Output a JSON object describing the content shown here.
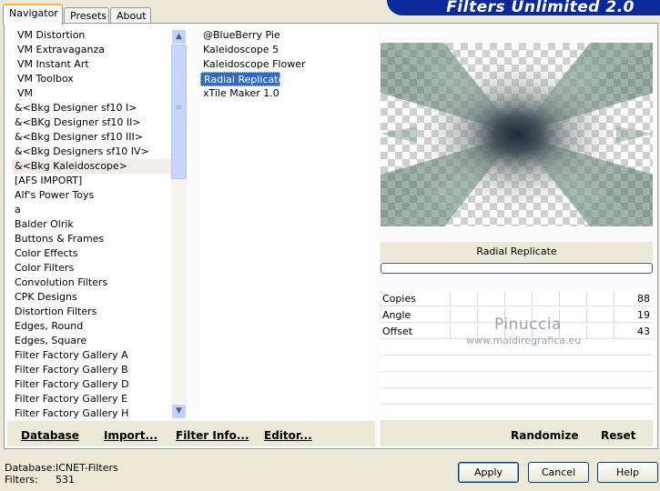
{
  "tabs": [
    {
      "label": "Navigator",
      "active": true
    },
    {
      "label": "Presets",
      "active": false
    },
    {
      "label": "About",
      "active": false
    }
  ],
  "banner_title": "Filters Unlimited 2.0",
  "categories": [
    "VM Distortion",
    "VM Extravaganza",
    "VM Instant Art",
    "VM Toolbox",
    "VM",
    "&<Bkg Designer sf10 I>",
    "&<BKg Designer sf10 II>",
    "&<Bkg Designer sf10 III>",
    "&<Bkg Designers sf10 IV>",
    "&<Bkg Kaleidoscope>",
    "[AFS IMPORT]",
    "Alf's Power Toys",
    "a",
    "Balder Olrik",
    "Buttons & Frames",
    "Color Effects",
    "Color Filters",
    "Convolution Filters",
    "CPK Designs",
    "Distortion Filters",
    "Edges, Round",
    "Edges, Square",
    "Filter Factory Gallery A",
    "Filter Factory Gallery B",
    "Filter Factory Gallery D",
    "Filter Factory Gallery E",
    "Filter Factory Gallery H"
  ],
  "selected_category": "&<Bkg Kaleidoscope>",
  "filters": [
    "@BlueBerry Pie",
    "Kaleidoscope 5",
    "Kaleidoscope Flower",
    "Radial Replicate",
    "xTile Maker 1.0"
  ],
  "selected_filter": "Radial Replicate",
  "preview_title": "Radial Replicate",
  "params": [
    {
      "label": "Copies",
      "value": "88"
    },
    {
      "label": "Angle",
      "value": "19"
    },
    {
      "label": "Offset",
      "value": "43"
    }
  ],
  "watermark": {
    "title": "Pinuccia",
    "url": "www.maidiregrafica.eu"
  },
  "left_buttons": {
    "database": "Database",
    "import": "Import...",
    "filter_info": "Filter Info...",
    "editor": "Editor..."
  },
  "right_buttons": {
    "randomize": "Randomize",
    "reset": "Reset"
  },
  "status": {
    "database_label": "Database:",
    "database_value": "ICNET-Filters",
    "filters_label": "Filters:",
    "filters_value": "531"
  },
  "dialog_buttons": {
    "apply": "Apply",
    "cancel": "Cancel",
    "help": "Help"
  },
  "colors": {
    "selection": "#316ac5",
    "banner": "#0a2a9c",
    "dialog_bg": "#ece9d8"
  }
}
